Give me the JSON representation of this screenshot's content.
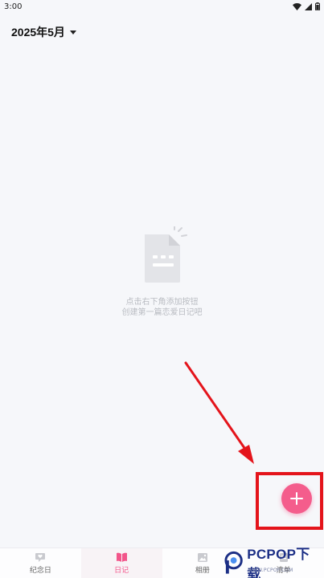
{
  "status_bar": {
    "time": "3:00",
    "icons": [
      "wifi-icon",
      "signal-icon",
      "battery-icon"
    ]
  },
  "header": {
    "month_label": "2025年5月",
    "dropdown_icon": "caret-down-icon"
  },
  "empty_state": {
    "icon": "document-icon",
    "line1": "点击右下角添加按钮",
    "line2": "创建第一篇恋爱日记吧"
  },
  "fab": {
    "icon": "plus-icon",
    "color": "#f45d8c"
  },
  "annotation": {
    "color": "#e4141b"
  },
  "tabs": [
    {
      "label": "纪念日",
      "icon": "heart-chat-icon",
      "active": false
    },
    {
      "label": "日记",
      "icon": "book-icon",
      "active": true
    },
    {
      "label": "相册",
      "icon": "image-icon",
      "active": false
    },
    {
      "label": "清单",
      "icon": "list-icon",
      "active": false
    }
  ],
  "watermark": {
    "brand": "PCPOP下载",
    "sub": "WWW.PCPOP.COM"
  },
  "colors": {
    "accent": "#f2558a",
    "background": "#f6f7fa"
  }
}
